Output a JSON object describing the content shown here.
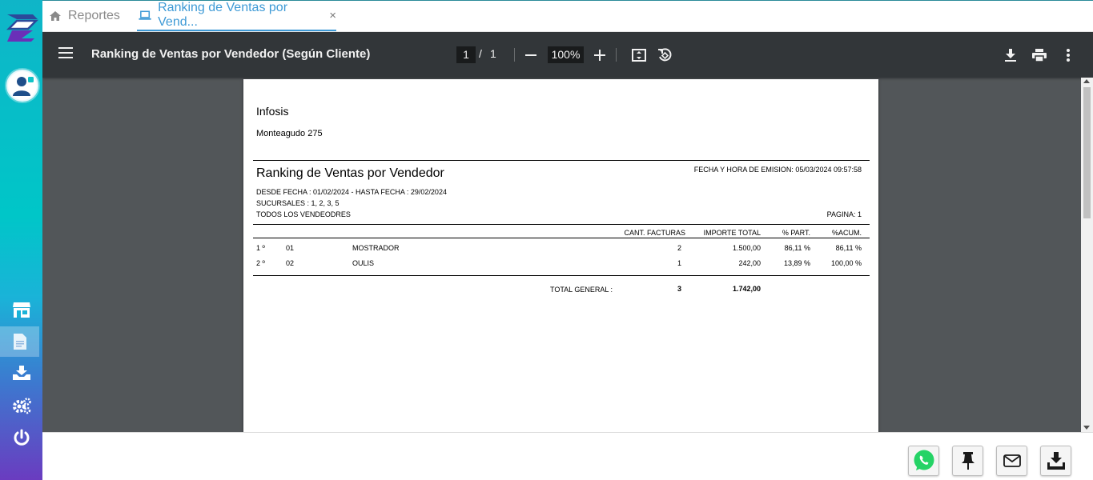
{
  "tabs": {
    "home_label": "Reportes",
    "active_label": "Ranking de Ventas por Vend...",
    "close_glyph": "×"
  },
  "viewer": {
    "title": "Ranking de Ventas por Vendedor (Según Cliente)",
    "current_page": "1",
    "page_separator": "/",
    "total_pages": "1",
    "zoom": "100%"
  },
  "report": {
    "company": "Infosis",
    "address": "Monteagudo 275",
    "title": "Ranking de Ventas por Vendedor",
    "emision": "FECHA Y HORA DE EMISION: 05/03/2024 09:57:58",
    "date_range": "DESDE FECHA : 01/02/2024 - HASTA FECHA : 29/02/2024",
    "sucursales": "SUCURSALES : 1, 2, 3, 5",
    "vendedores": "TODOS LOS VENDEODRES",
    "pagina": "PAGINA: 1",
    "columns": {
      "cant": "CANT. FACTURAS",
      "importe": "IMPORTE TOTAL",
      "part": "% PART.",
      "acum": "%ACUM."
    },
    "rows": [
      {
        "rank": "1 º",
        "code": "01",
        "name": "MOSTRADOR",
        "cant": "2",
        "importe": "1.500,00",
        "part": "86,11 %",
        "acum": "86,11 %"
      },
      {
        "rank": "2 º",
        "code": "02",
        "name": "OULIS",
        "cant": "1",
        "importe": "242,00",
        "part": "13,89 %",
        "acum": "100,00 %"
      }
    ],
    "total_label": "TOTAL GENERAL :",
    "total_cant": "3",
    "total_importe": "1.742,00"
  },
  "colors": {
    "accent": "#3e9ad6",
    "toolbar": "#323639",
    "viewer_bg": "#525659",
    "whatsapp": "#25d366"
  },
  "icons": {
    "sidebar": [
      "logo-icon",
      "user-avatar-icon",
      "store-icon",
      "document-icon",
      "download-tray-icon",
      "gears-icon",
      "power-icon"
    ],
    "toolbar": [
      "menu-icon",
      "zoom-out-icon",
      "zoom-in-icon",
      "fit-page-icon",
      "rotate-icon",
      "download-icon",
      "print-icon",
      "more-vert-icon"
    ],
    "actions": [
      "whatsapp-icon",
      "pin-icon",
      "mail-icon",
      "download-icon"
    ]
  }
}
